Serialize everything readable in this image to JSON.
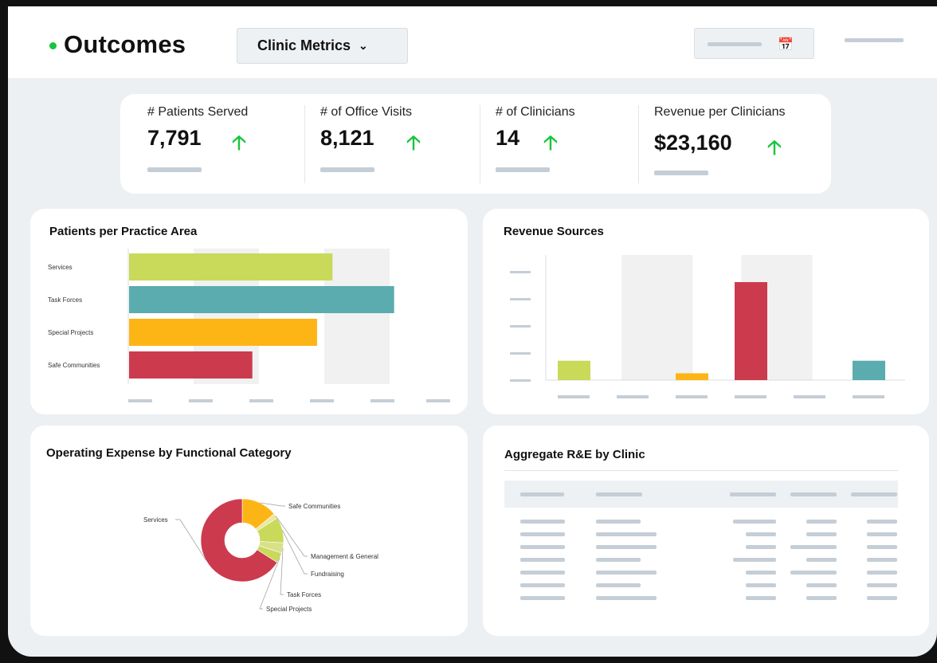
{
  "header": {
    "title": "Outcomes",
    "dropdown_label": "Clinic Metrics",
    "dropdown_icon": "chevron-down-icon",
    "date_picker_icon": "calendar-icon",
    "brand_color": "#19c43e"
  },
  "kpis": [
    {
      "label": "# Patients Served",
      "value": "7,791",
      "trend": "up"
    },
    {
      "label": "# of Office Visits",
      "value": "8,121",
      "trend": "up"
    },
    {
      "label": "# of Clinicians",
      "value": "14",
      "trend": "up"
    },
    {
      "label": "Revenue per Clinicians",
      "value": "$23,160",
      "trend": "up"
    }
  ],
  "colors": {
    "green": "#c9d95a",
    "teal": "#5aacaf",
    "amber": "#fdb515",
    "red": "#cc3a4e",
    "trend_up": "#19c43e"
  },
  "chart_data": [
    {
      "type": "bar",
      "title": "Patients per Practice Area",
      "orientation": "horizontal",
      "categories": [
        "Services",
        "Task Forces",
        "Special Projects",
        "Safe Communities"
      ],
      "values": [
        66,
        86,
        61,
        40
      ],
      "xlim": [
        0,
        106
      ],
      "colors": [
        "#c9d95a",
        "#5aacaf",
        "#fdb515",
        "#cc3a4e"
      ],
      "grid": "alternating bands"
    },
    {
      "type": "bar",
      "title": "Revenue Sources",
      "categories": [
        "",
        "",
        "",
        "",
        "",
        ""
      ],
      "values": [
        17,
        0,
        6,
        86,
        0,
        17
      ],
      "ylim": [
        0,
        100
      ],
      "colors": [
        "#c9d95a",
        "#c9d95a",
        "#fdb515",
        "#cc3a4e",
        "#5aacaf",
        "#5aacaf"
      ],
      "grid": "alternating bands"
    },
    {
      "type": "pie",
      "title": "Operating Expense by Functional Category",
      "donut": true,
      "slices": [
        {
          "label": "Safe Communities",
          "value": 14,
          "color": "#fdb515"
        },
        {
          "label": "Management & General",
          "value": 2,
          "color": "#e8e8a0"
        },
        {
          "label": "Fundraising",
          "value": 10,
          "color": "#c9d95a"
        },
        {
          "label": "Task Forces",
          "value": 4,
          "color": "#d9e08a"
        },
        {
          "label": "Special Projects",
          "value": 4,
          "color": "#c9d95a"
        },
        {
          "label": "Services",
          "value": 66,
          "color": "#cc3a4e"
        }
      ]
    }
  ],
  "table": {
    "title": "Aggregate R&E by Clinic"
  }
}
